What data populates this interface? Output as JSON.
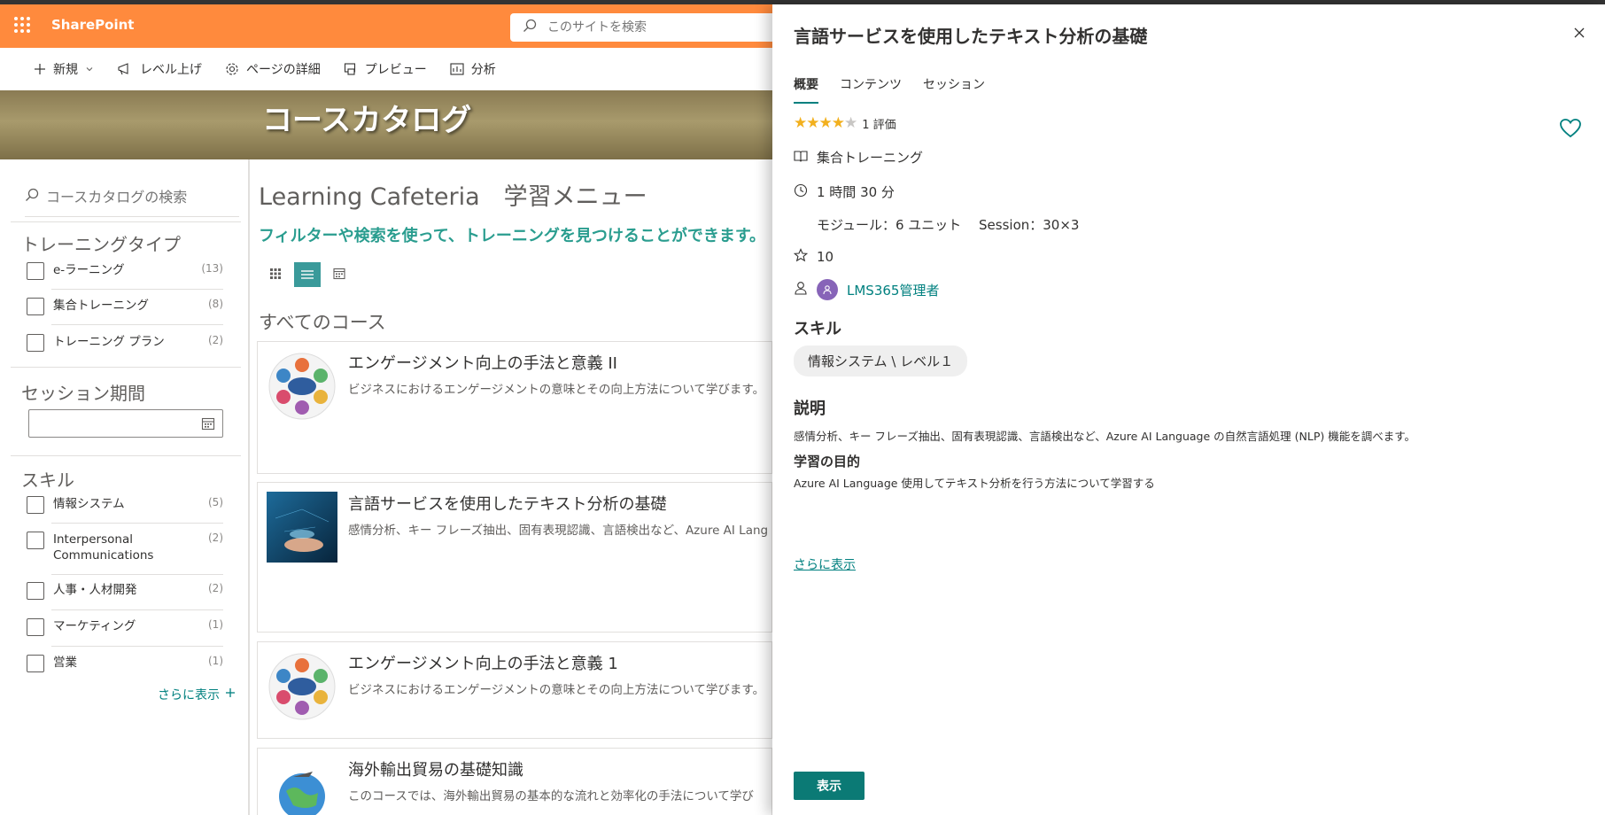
{
  "app": {
    "brand": "SharePoint",
    "search_placeholder": "このサイトを検索"
  },
  "commandbar": {
    "new": "新規",
    "promote": "レベル上げ",
    "page_details": "ページの詳細",
    "preview": "プレビュー",
    "analytics": "分析"
  },
  "hero": {
    "title": "コースカタログ"
  },
  "filters": {
    "search_placeholder": "コースカタログの検索",
    "training_type": {
      "title": "トレーニングタイプ",
      "items": [
        {
          "label": "e-ラーニング",
          "count": "(13)"
        },
        {
          "label": "集合トレーニング",
          "count": "(8)"
        },
        {
          "label": "トレーニング プラン",
          "count": "(2)"
        }
      ]
    },
    "session_period": {
      "title": "セッション期間"
    },
    "skills": {
      "title": "スキル",
      "items": [
        {
          "label": "情報システム",
          "count": "(5)"
        },
        {
          "label": "Interpersonal Communications",
          "count": "(2)"
        },
        {
          "label": "人事・人材開発",
          "count": "(2)"
        },
        {
          "label": "マーケティング",
          "count": "(1)"
        },
        {
          "label": "営業",
          "count": "(1)"
        }
      ]
    },
    "show_more": "さらに表示"
  },
  "main": {
    "title": "Learning Cafeteria　学習メニュー",
    "subtitle": "フィルターや検索を使って、トレーニングを見つけることができます。",
    "section_title": "すべてのコース",
    "courses": [
      {
        "title": "エンゲージメント向上の手法と意義 II",
        "desc": "ビジネスにおけるエンゲージメントの意味とその向上方法について学びます。"
      },
      {
        "title": "言語サービスを使用したテキスト分析の基礎",
        "desc": "感情分析、キー フレーズ抽出、固有表現認識、言語検出など、Azure AI Lang"
      },
      {
        "title": "エンゲージメント向上の手法と意義 1",
        "desc": "ビジネスにおけるエンゲージメントの意味とその向上方法について学びます。"
      },
      {
        "title": "海外輸出貿易の基礎知識",
        "desc": "このコースでは、海外輸出貿易の基本的な流れと効率化の手法について学び"
      }
    ]
  },
  "panel": {
    "title": "言語サービスを使用したテキスト分析の基礎",
    "tabs": [
      "概要",
      "コンテンツ",
      "セッション"
    ],
    "rating_value": 4,
    "rating_max": 5,
    "rating_text": "1 評価",
    "type": "集合トレーニング",
    "duration": "1 時間 30 分",
    "modules": "モジュール：6 ユニット　 Session：30×3",
    "points": "10",
    "author": "LMS365管理者",
    "skills_heading": "スキル",
    "skill": "情報システム \\ レベル１",
    "desc_heading": "説明",
    "description": "感情分析、キー フレーズ抽出、固有表現認識、言語検出など、Azure AI Language の自然言語処理 (NLP) 機能を調べます。",
    "goal_heading": "学習の目的",
    "goal": "Azure AI Language 使用してテキスト分析を行う方法について学習する",
    "show_more": "さらに表示",
    "show_button": "表示"
  },
  "colors": {
    "accent": "#ff8a3d",
    "teal": "#00807f",
    "button": "#0b7a75",
    "star": "#f2b01e"
  }
}
